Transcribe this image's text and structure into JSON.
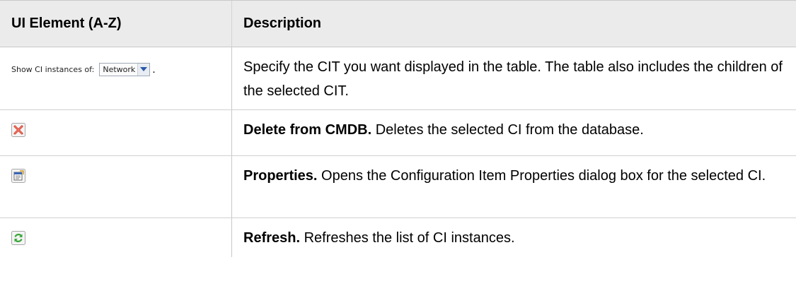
{
  "table": {
    "headers": {
      "ui_element": "UI Element (A-Z)",
      "description": "Description"
    },
    "rows": [
      {
        "element": {
          "label": "Show CI instances of:",
          "selected_value": "Network",
          "trailing": "."
        },
        "description": "Specify the CIT you want displayed in the table. The table also includes the children of the selected CIT."
      },
      {
        "icon": "delete-x-icon",
        "term": "Delete from CMDB.",
        "description": " Deletes the selected CI from the database."
      },
      {
        "icon": "properties-icon",
        "term": "Properties.",
        "description": " Opens the Configuration Item Properties dialog box for the selected CI."
      },
      {
        "icon": "refresh-icon",
        "term": "Refresh.",
        "description": " Refreshes the list of CI instances."
      }
    ]
  },
  "colors": {
    "header_bg": "#ebebeb",
    "delete_red": "#d93a2a",
    "refresh_green": "#3aa53a"
  }
}
